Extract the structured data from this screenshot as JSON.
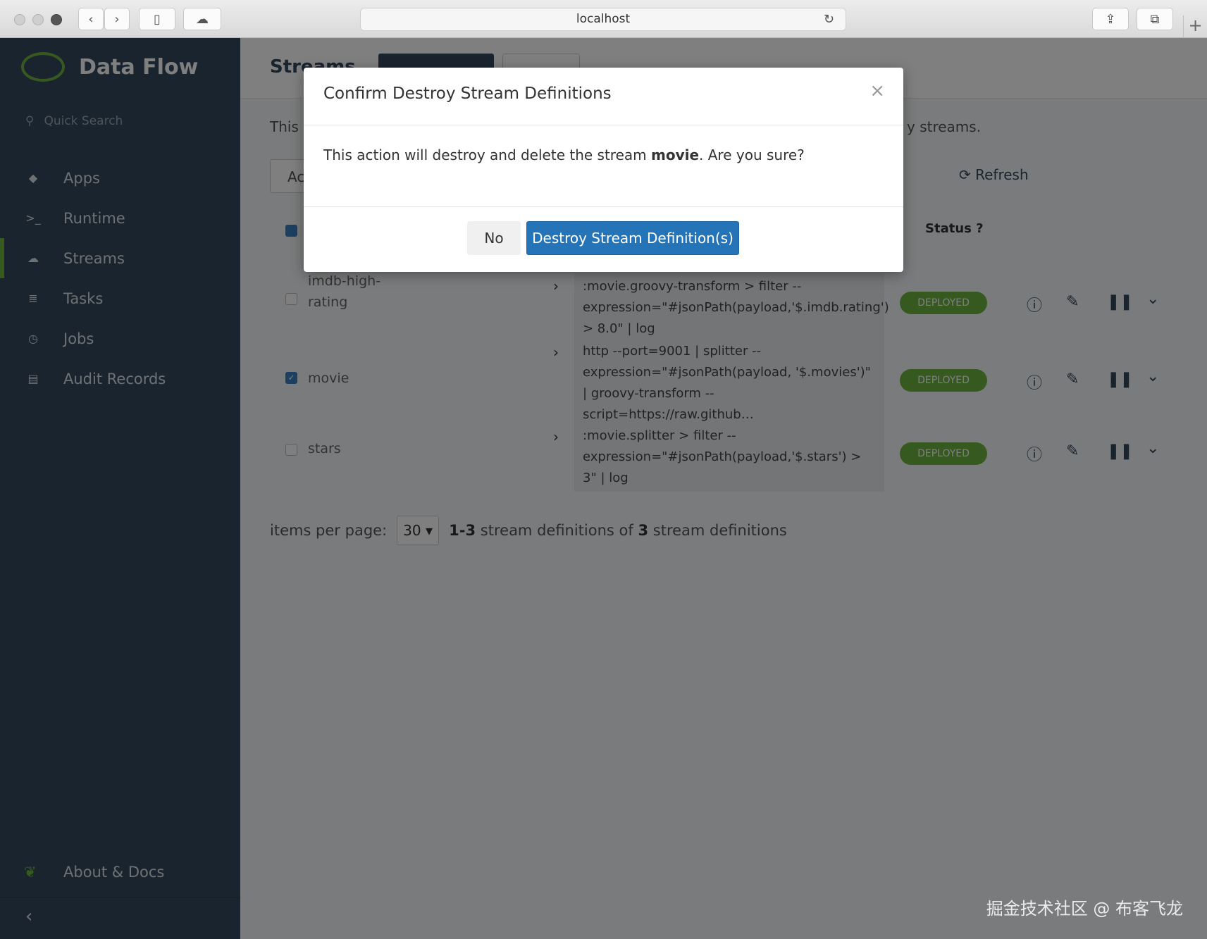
{
  "browser": {
    "address": "localhost",
    "reload_icon": "↻",
    "back_icon": "‹",
    "forward_icon": "›",
    "sidebar_icon": "▯",
    "cloud_icon": "☁",
    "share_icon": "⇪",
    "tabs_icon": "⧉",
    "newtab_icon": "+"
  },
  "sidebar": {
    "brand": "Data Flow",
    "quick_search": "Quick Search",
    "search_icon": "⚲",
    "items": [
      {
        "label": "Apps",
        "icon": "tags-icon",
        "glyph": "◆"
      },
      {
        "label": "Runtime",
        "icon": "terminal-icon",
        "glyph": ">_"
      },
      {
        "label": "Streams",
        "icon": "cloud-icon",
        "glyph": "☁"
      },
      {
        "label": "Tasks",
        "icon": "tasks-icon",
        "glyph": "≣"
      },
      {
        "label": "Jobs",
        "icon": "clock-icon",
        "glyph": "◷"
      },
      {
        "label": "Audit Records",
        "icon": "list-icon",
        "glyph": "▤"
      }
    ],
    "about": "About & Docs",
    "about_glyph": "❦",
    "collapse_glyph": "‹"
  },
  "main": {
    "title": "Streams",
    "desc_start": "This",
    "desc_end": "y streams.",
    "search_prefix": "Ac",
    "refresh": "Refresh",
    "refresh_icon": "⟳",
    "status_header": "Status",
    "status_help": "?",
    "rows": [
      {
        "name": "imdb-high-rating",
        "dsl": ":movie.groovy-transform > filter --expression=\"#jsonPath(payload,'$.imdb.rating') > 8.0\" | log",
        "status": "DEPLOYED",
        "checked": false
      },
      {
        "name": "movie",
        "dsl": "http --port=9001 | splitter --expression=\"#jsonPath(payload, '$.movies')\" | groovy-transform --script=https://raw.github…",
        "status": "DEPLOYED",
        "checked": true
      },
      {
        "name": "stars",
        "dsl": ":movie.splitter > filter --expression=\"#jsonPath(payload,'$.stars') > 3\" | log",
        "status": "DEPLOYED",
        "checked": false
      }
    ],
    "chevron": "›",
    "icons": {
      "info": "ⓘ",
      "edit": "✎",
      "pause": "❚❚",
      "more": "⌄"
    },
    "items_per_page_label": "items per page:",
    "items_per_page": "30 ▾",
    "summary_range": "1-3",
    "summary_mid": "stream definitions of",
    "summary_total": "3",
    "summary_end": "stream definitions"
  },
  "modal": {
    "title": "Confirm Destroy Stream Definitions",
    "close": "×",
    "body_start": "This action will destroy and delete the stream ",
    "body_stream": "movie",
    "body_end": ". Are you sure?",
    "no_label": "No",
    "destroy_label": "Destroy Stream Definition(s)"
  },
  "watermark": "掘金技术社区 @ 布客飞龙",
  "colors": {
    "accent": "#6db33f",
    "sidebar": "#34495e",
    "primary": "#2574b8"
  }
}
